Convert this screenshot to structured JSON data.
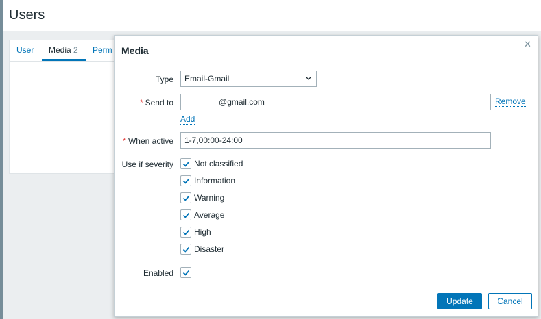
{
  "page": {
    "title": "Users"
  },
  "tabs": [
    {
      "label": "User",
      "count": ""
    },
    {
      "label": "Media",
      "count": "2"
    },
    {
      "label": "Perm",
      "count": ""
    }
  ],
  "modal": {
    "title": "Media",
    "close_icon": "close-icon",
    "fields": {
      "type": {
        "label": "Type",
        "value": "Email-Gmail"
      },
      "send_to": {
        "label": "Send to",
        "value": "               @gmail.com",
        "remove_label": "Remove",
        "add_label": "Add"
      },
      "when_active": {
        "label": "When active",
        "value": "1-7,00:00-24:00"
      },
      "severity": {
        "label": "Use if severity",
        "options": [
          {
            "label": "Not classified",
            "checked": true
          },
          {
            "label": "Information",
            "checked": true
          },
          {
            "label": "Warning",
            "checked": true
          },
          {
            "label": "Average",
            "checked": true
          },
          {
            "label": "High",
            "checked": true
          },
          {
            "label": "Disaster",
            "checked": true
          }
        ]
      },
      "enabled": {
        "label": "Enabled",
        "checked": true
      }
    },
    "buttons": {
      "update": "Update",
      "cancel": "Cancel"
    }
  },
  "colors": {
    "accent": "#0275b8",
    "required": "#e33734",
    "text": "#1f2c33",
    "border": "#a3b1b9"
  }
}
